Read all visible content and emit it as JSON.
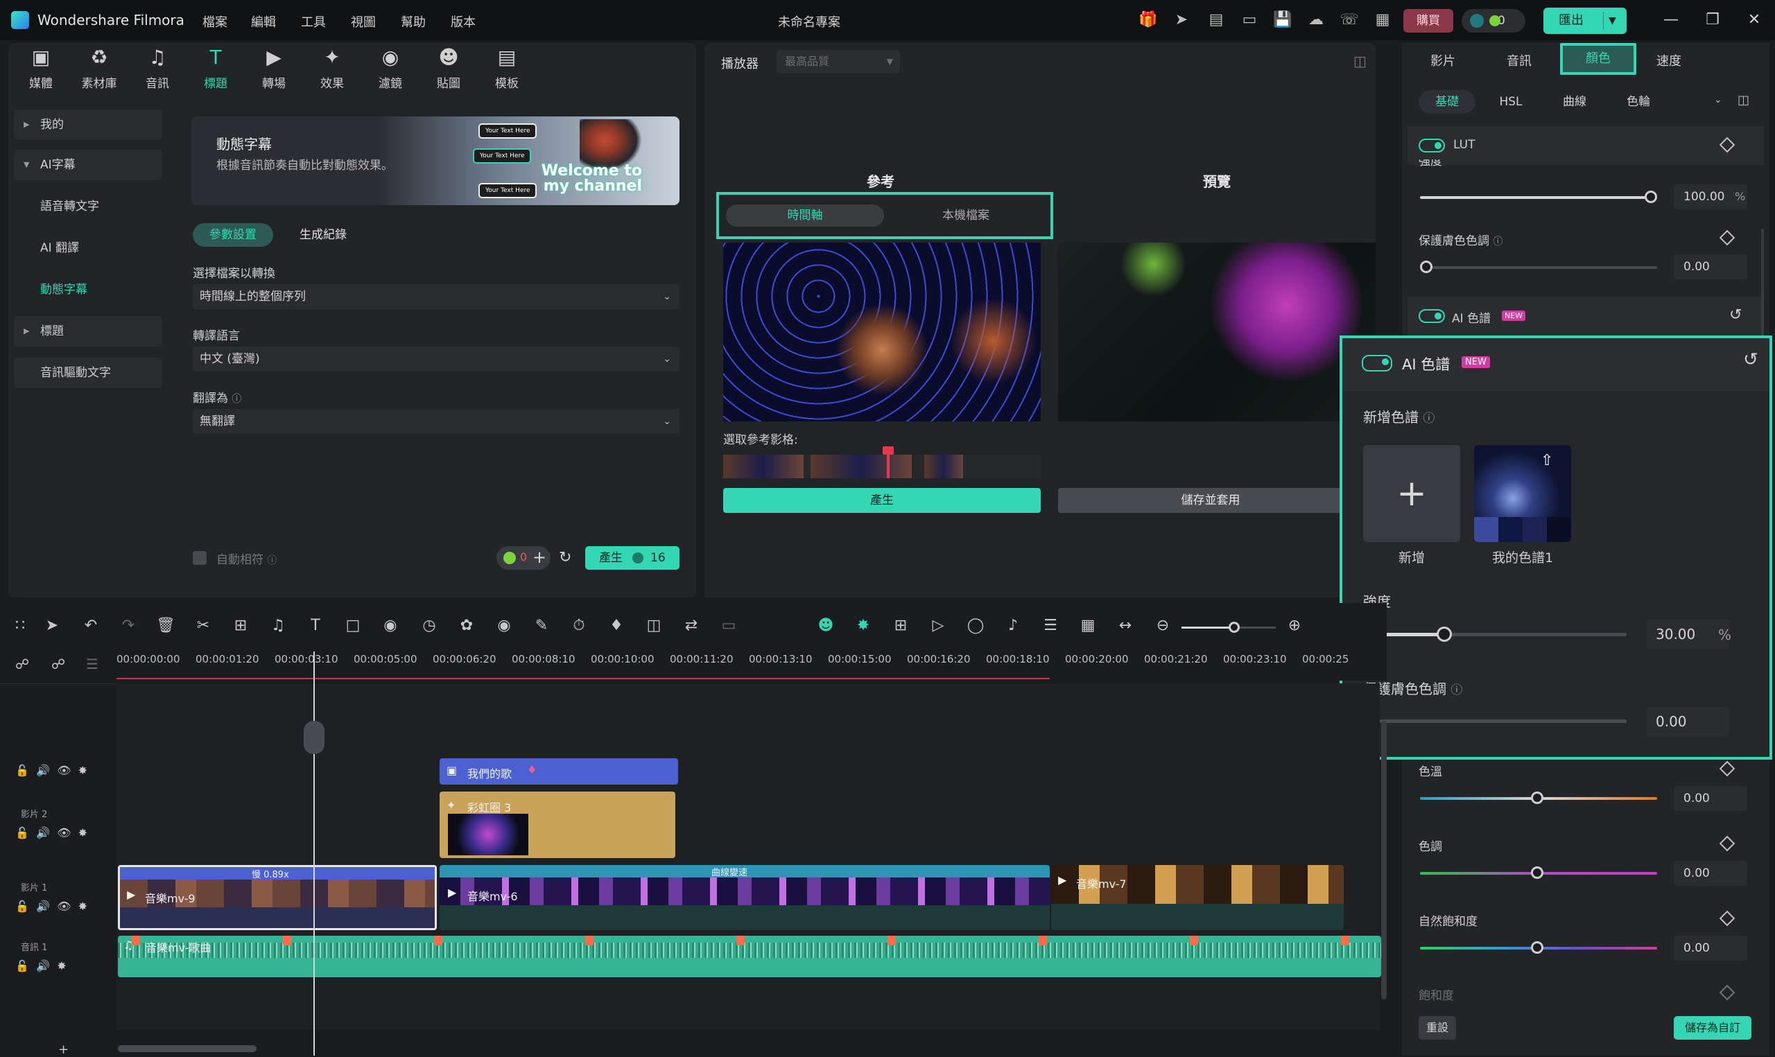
{
  "app": {
    "name": "Wondershare Filmora",
    "project_title": "未命名專案"
  },
  "menu": [
    "檔案",
    "編輯",
    "工具",
    "視圖",
    "幫助",
    "版本"
  ],
  "topbar": {
    "buy_label": "購買",
    "credit_count": "0",
    "export_label": "匯出"
  },
  "toolbar_tabs": [
    {
      "label": "媒體",
      "icon": "media-icon"
    },
    {
      "label": "素材庫",
      "icon": "stock-icon"
    },
    {
      "label": "音訊",
      "icon": "music-icon"
    },
    {
      "label": "標題",
      "icon": "title-icon"
    },
    {
      "label": "轉場",
      "icon": "transition-icon"
    },
    {
      "label": "效果",
      "icon": "effects-icon"
    },
    {
      "label": "濾鏡",
      "icon": "filter-icon"
    },
    {
      "label": "貼圖",
      "icon": "sticker-icon"
    },
    {
      "label": "模板",
      "icon": "template-icon"
    }
  ],
  "sidebar": [
    {
      "label": "我的"
    },
    {
      "label": "AI字幕"
    },
    {
      "label": "語音轉文字"
    },
    {
      "label": "AI 翻譯"
    },
    {
      "label": "動態字幕"
    },
    {
      "label": "標題"
    },
    {
      "label": "音訊驅動文字"
    }
  ],
  "banner": {
    "title": "動態字幕",
    "subtitle": "根據音訊節奏自動比對動態效果。",
    "tag1": "Your Text Here",
    "tag2": "Your Text Here",
    "tag3": "Your Text Here",
    "welcome": "Welcome to my channel"
  },
  "settings": {
    "tab_params": "參數設置",
    "tab_history": "生成紀錄",
    "select_file_label": "選擇檔案以轉換",
    "select_file_value": "時間線上的整個序列",
    "language_label": "轉譯語言",
    "language_value": "中文 (臺灣)",
    "translate_label": "翻譯為",
    "translate_value": "無翻譯",
    "auto_match_label": "自動相符",
    "credit_red": "0",
    "generate_label": "產生",
    "generate_cost": "16"
  },
  "player": {
    "label": "播放器",
    "quality": "最高品質"
  },
  "ai_palette": {
    "ref_heading": "參考",
    "preview_heading": "預覽",
    "seg_timeline": "時間軸",
    "seg_local": "本機檔案",
    "select_ref_frame": "選取參考影格:",
    "generate_btn": "產生",
    "save_apply_btn": "儲存並套用"
  },
  "right": {
    "tabs": [
      "影片",
      "音訊",
      "顏色",
      "速度"
    ],
    "subtabs": [
      "基礎",
      "HSL",
      "曲線",
      "色輪"
    ],
    "lut_label": "LUT",
    "strength_label_partial": "強度",
    "strength_value": "100.00",
    "strength_pct": "%",
    "protect_label": "保護膚色色調",
    "protect_value": "0.00",
    "ai_palette_label": "AI 色譜",
    "new_badge": "NEW",
    "temp_label": "色溫",
    "temp_value": "0.00",
    "tint_label": "色調",
    "tint_value": "0.00",
    "vibrance_label": "自然飽和度",
    "vibrance_value": "0.00",
    "saturation_label": "飽和度",
    "reset_btn": "重設",
    "save_custom_btn": "儲存為自訂"
  },
  "popup": {
    "title": "AI 色譜",
    "badge": "NEW",
    "add_palette_label": "新增色譜",
    "add_label": "新增",
    "my_palette_label": "我的色譜1",
    "strength_label": "強度",
    "strength_value": "30.00",
    "strength_pct": "%",
    "strength_fraction": 0.3,
    "protect_label": "保護膚色色調",
    "protect_value": "0.00"
  },
  "timeline": {
    "ticks": [
      "00:00:00:00",
      "00:00:01:20",
      "00:00:03:10",
      "00:00:05:00",
      "00:00:06:20",
      "00:00:08:10",
      "00:00:10:00",
      "00:00:11:20",
      "00:00:13:10",
      "00:00:15:00",
      "00:00:16:20",
      "00:00:18:10",
      "00:00:20:00",
      "00:00:21:20",
      "00:00:23:10",
      "00:00:25"
    ],
    "track_video2": "影片 2",
    "track_video1": "影片 1",
    "track_audio1": "音訊 1",
    "clip_title": "我們的歌",
    "clip_effect": "彩虹圈 3",
    "clip_speed": "慢 0.89x",
    "clip_v1a": "音樂mv-9",
    "clip_transition": "曲線變速",
    "clip_v1b": "音樂mv-6",
    "clip_v1c": "音樂mv-7",
    "clip_audio": "音樂mv-歌曲"
  }
}
